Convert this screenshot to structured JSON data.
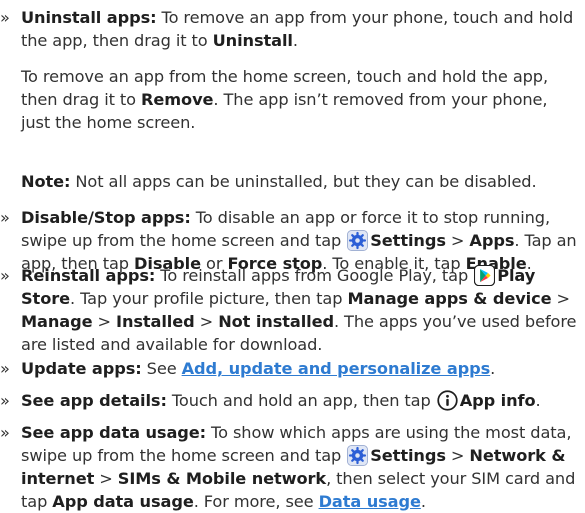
{
  "uninstall": {
    "term": "Uninstall apps:",
    "t1": " To remove an app from your phone, touch and hold the app, then drag it to ",
    "b1": "Uninstall",
    "t2": "."
  },
  "home_remove": {
    "t1": "To remove an app from the home screen, touch and hold the app, then drag it to ",
    "b1": "Remove",
    "t2": ". The app isn’t removed from your phone, just the home screen."
  },
  "note": {
    "label": "Note:",
    "text": " Not all apps can be uninstalled, but they can be disabled."
  },
  "disable": {
    "term": "Disable/Stop apps:",
    "t1": " To disable an app or force it to stop running, swipe up from the home screen and tap ",
    "b1": "Settings",
    "t2": " > ",
    "b2": "Apps",
    "t3": ". Tap an app, then tap ",
    "b3": "Disable",
    "t4": " or ",
    "b4": "Force stop",
    "t5": ". To enable it, tap ",
    "b5": "Enable",
    "t6": "."
  },
  "reinstall": {
    "term": "Reinstall apps:",
    "t1": " To reinstall apps from Google Play, tap ",
    "b1": "Play Store",
    "t2": ". Tap your profile picture, then tap ",
    "b2": "Manage apps & device",
    "t3": " > ",
    "b3": "Manage",
    "t4": " > ",
    "b4": "Installed",
    "t5": " > ",
    "b5": "Not installed",
    "t6": ". The apps you’ve used before are listed and available for download."
  },
  "update": {
    "term": "Update apps:",
    "t1": " See ",
    "link": "Add, update and personalize apps",
    "t2": "."
  },
  "details": {
    "term": "See app details:",
    "t1": " Touch and hold an app, then tap ",
    "b1": "App info",
    "t2": "."
  },
  "usage": {
    "term": "See app data usage:",
    "t1": " To show which apps are using the most data, swipe up from the home screen and tap ",
    "b1": "Settings",
    "t2": " > ",
    "b2": "Network & internet",
    "t3": " > ",
    "b3": "SIMs & Mobile network",
    "t4": ", then select your SIM card and tap ",
    "b4": "App data usage",
    "t5": ". For more, see ",
    "link": "Data usage",
    "t6": "."
  },
  "bullet": "»",
  "icons": {
    "settings": "settings-gear-icon",
    "play_store": "play-store-icon",
    "info": "info-circle-icon"
  },
  "colors": {
    "link": "#2e7bd1",
    "settings_icon_bg": "#dfe6f5",
    "settings_icon_fg": "#2c5fd6"
  }
}
